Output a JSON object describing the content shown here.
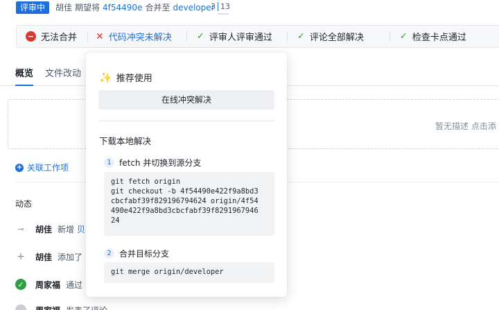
{
  "header": {
    "status": "评审中",
    "author": "胡佳",
    "text_expect": "期望将",
    "commit": "4f54490e",
    "text_merge_to": "合并至",
    "target_branch": "developer",
    "count_a": "3",
    "count_b": "13"
  },
  "checks": [
    {
      "label": "无法合并",
      "state": "fail"
    },
    {
      "label": "代码冲突未解决",
      "state": "conflict"
    },
    {
      "label": "评审人评审通过",
      "state": "ok"
    },
    {
      "label": "评论全部解决",
      "state": "ok"
    },
    {
      "label": "检查卡点通过",
      "state": "ok"
    }
  ],
  "tabs": [
    "概览",
    "文件改动"
  ],
  "description": {
    "empty_text": "暂无描述 点击添"
  },
  "link_work_item": "关联工作项",
  "activity": {
    "title": "动态",
    "items": [
      {
        "name": "胡佳",
        "verb": "新增",
        "object": "贝"
      },
      {
        "name": "胡佳",
        "verb": "添加了",
        "object": ""
      },
      {
        "name": "周家福",
        "verb": "通过",
        "object": ""
      },
      {
        "name": "周家福",
        "verb": "发表了评论",
        "object": ""
      }
    ]
  },
  "popover": {
    "recommend_title": "推荐使用",
    "online_button": "在线冲突解决",
    "download_title": "下载本地解决",
    "steps": [
      {
        "num": "1",
        "label": "fetch 并切换到源分支",
        "code": "git fetch origin\ngit checkout -b 4f54490e422f9a8bd3\ncbcfabf39f829196794624 origin/4f54\n490e422f9a8bd3cbcfabf39f8291967946\n24"
      },
      {
        "num": "2",
        "label": "合并目标分支",
        "code": "git merge origin/developer"
      }
    ]
  },
  "colors": {
    "accent": "#1e6fd9",
    "fail": "#d9382f",
    "ok": "#2e9d43"
  }
}
